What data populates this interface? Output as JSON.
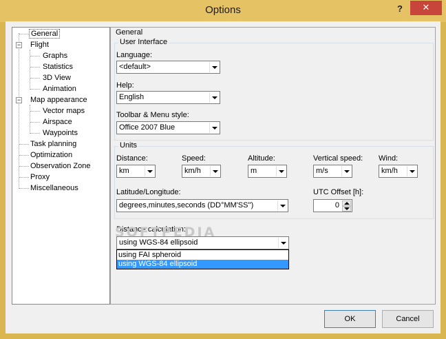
{
  "window": {
    "title": "Options",
    "help_glyph": "?",
    "close_glyph": "✕"
  },
  "tree": {
    "items": [
      {
        "label": "General",
        "level": 0,
        "selected": true
      },
      {
        "label": "Flight",
        "level": 0,
        "expanded": true
      },
      {
        "label": "Graphs",
        "level": 1
      },
      {
        "label": "Statistics",
        "level": 1
      },
      {
        "label": "3D View",
        "level": 1
      },
      {
        "label": "Animation",
        "level": 1
      },
      {
        "label": "Map appearance",
        "level": 0,
        "expanded": true
      },
      {
        "label": "Vector maps",
        "level": 1
      },
      {
        "label": "Airspace",
        "level": 1
      },
      {
        "label": "Waypoints",
        "level": 1
      },
      {
        "label": "Task planning",
        "level": 0
      },
      {
        "label": "Optimization",
        "level": 0
      },
      {
        "label": "Observation Zone",
        "level": 0
      },
      {
        "label": "Proxy",
        "level": 0
      },
      {
        "label": "Miscellaneous",
        "level": 0
      }
    ],
    "expander_minus": "−"
  },
  "general": {
    "group_title": "General",
    "user_interface": {
      "title": "User Interface",
      "language_label": "Language:",
      "language_value": "<default>",
      "help_label": "Help:",
      "help_value": "English",
      "toolbar_label": "Toolbar & Menu style:",
      "toolbar_value": "Office 2007 Blue"
    },
    "units": {
      "title": "Units",
      "distance_label": "Distance:",
      "distance_value": "km",
      "speed_label": "Speed:",
      "speed_value": "km/h",
      "altitude_label": "Altitude:",
      "altitude_value": "m",
      "vspeed_label": "Vertical speed:",
      "vspeed_value": "m/s",
      "wind_label": "Wind:",
      "wind_value": "km/h",
      "latlon_label": "Latitude/Longitude:",
      "latlon_value": "degrees,minutes,seconds (DD°MM'SS'')",
      "utc_label": "UTC Offset [h]:",
      "utc_value": "0"
    },
    "distance_calc": {
      "label": "Distance calculation:",
      "value": "using WGS-84 ellipsoid",
      "options": [
        "using FAI spheroid",
        "using WGS-84 ellipsoid"
      ],
      "highlighted_index": 1
    }
  },
  "watermark": "SOFTPEDIA",
  "buttons": {
    "ok": "OK",
    "cancel": "Cancel"
  }
}
